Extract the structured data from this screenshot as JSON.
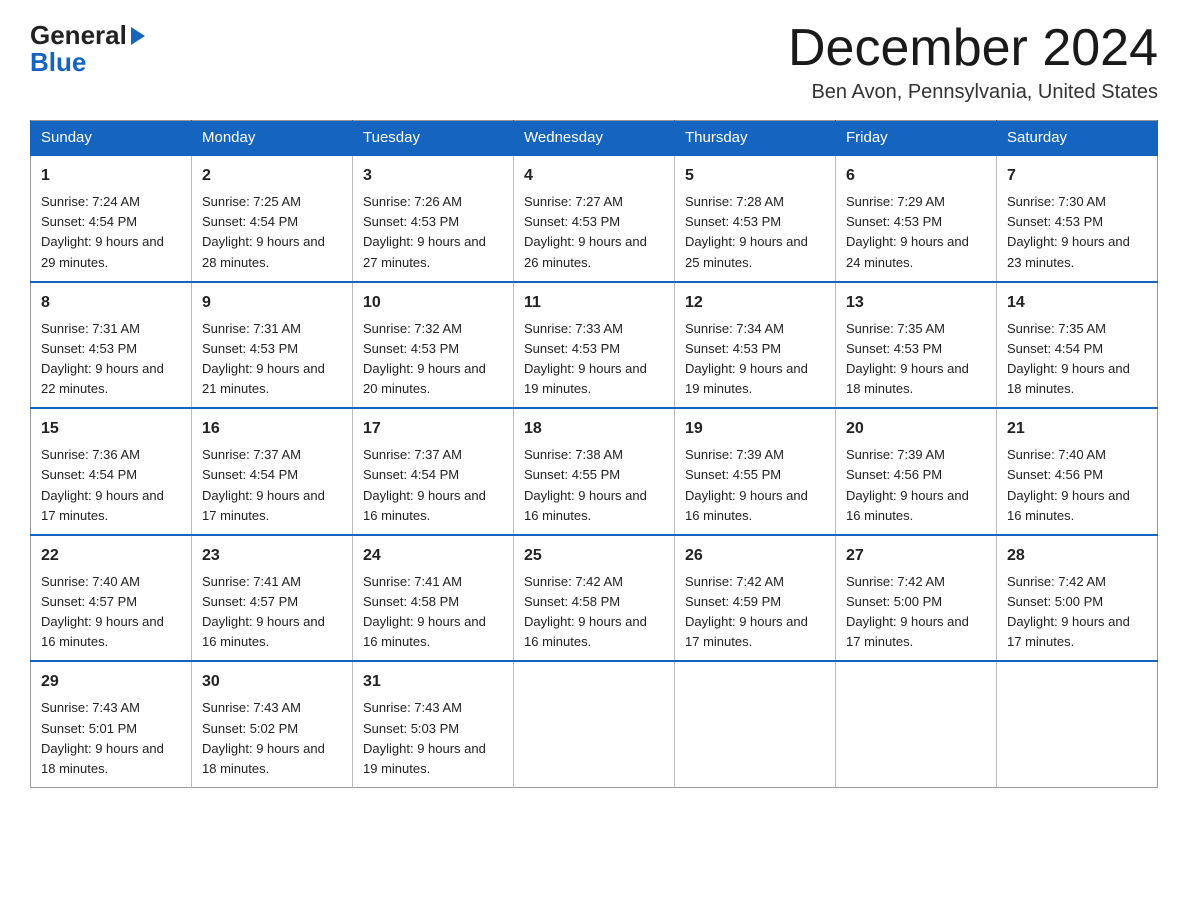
{
  "header": {
    "logo_line1": "General",
    "logo_line2": "Blue",
    "month_title": "December 2024",
    "location": "Ben Avon, Pennsylvania, United States"
  },
  "weekdays": [
    "Sunday",
    "Monday",
    "Tuesday",
    "Wednesday",
    "Thursday",
    "Friday",
    "Saturday"
  ],
  "weeks": [
    [
      {
        "day": "1",
        "sunrise": "7:24 AM",
        "sunset": "4:54 PM",
        "daylight": "9 hours and 29 minutes."
      },
      {
        "day": "2",
        "sunrise": "7:25 AM",
        "sunset": "4:54 PM",
        "daylight": "9 hours and 28 minutes."
      },
      {
        "day": "3",
        "sunrise": "7:26 AM",
        "sunset": "4:53 PM",
        "daylight": "9 hours and 27 minutes."
      },
      {
        "day": "4",
        "sunrise": "7:27 AM",
        "sunset": "4:53 PM",
        "daylight": "9 hours and 26 minutes."
      },
      {
        "day": "5",
        "sunrise": "7:28 AM",
        "sunset": "4:53 PM",
        "daylight": "9 hours and 25 minutes."
      },
      {
        "day": "6",
        "sunrise": "7:29 AM",
        "sunset": "4:53 PM",
        "daylight": "9 hours and 24 minutes."
      },
      {
        "day": "7",
        "sunrise": "7:30 AM",
        "sunset": "4:53 PM",
        "daylight": "9 hours and 23 minutes."
      }
    ],
    [
      {
        "day": "8",
        "sunrise": "7:31 AM",
        "sunset": "4:53 PM",
        "daylight": "9 hours and 22 minutes."
      },
      {
        "day": "9",
        "sunrise": "7:31 AM",
        "sunset": "4:53 PM",
        "daylight": "9 hours and 21 minutes."
      },
      {
        "day": "10",
        "sunrise": "7:32 AM",
        "sunset": "4:53 PM",
        "daylight": "9 hours and 20 minutes."
      },
      {
        "day": "11",
        "sunrise": "7:33 AM",
        "sunset": "4:53 PM",
        "daylight": "9 hours and 19 minutes."
      },
      {
        "day": "12",
        "sunrise": "7:34 AM",
        "sunset": "4:53 PM",
        "daylight": "9 hours and 19 minutes."
      },
      {
        "day": "13",
        "sunrise": "7:35 AM",
        "sunset": "4:53 PM",
        "daylight": "9 hours and 18 minutes."
      },
      {
        "day": "14",
        "sunrise": "7:35 AM",
        "sunset": "4:54 PM",
        "daylight": "9 hours and 18 minutes."
      }
    ],
    [
      {
        "day": "15",
        "sunrise": "7:36 AM",
        "sunset": "4:54 PM",
        "daylight": "9 hours and 17 minutes."
      },
      {
        "day": "16",
        "sunrise": "7:37 AM",
        "sunset": "4:54 PM",
        "daylight": "9 hours and 17 minutes."
      },
      {
        "day": "17",
        "sunrise": "7:37 AM",
        "sunset": "4:54 PM",
        "daylight": "9 hours and 16 minutes."
      },
      {
        "day": "18",
        "sunrise": "7:38 AM",
        "sunset": "4:55 PM",
        "daylight": "9 hours and 16 minutes."
      },
      {
        "day": "19",
        "sunrise": "7:39 AM",
        "sunset": "4:55 PM",
        "daylight": "9 hours and 16 minutes."
      },
      {
        "day": "20",
        "sunrise": "7:39 AM",
        "sunset": "4:56 PM",
        "daylight": "9 hours and 16 minutes."
      },
      {
        "day": "21",
        "sunrise": "7:40 AM",
        "sunset": "4:56 PM",
        "daylight": "9 hours and 16 minutes."
      }
    ],
    [
      {
        "day": "22",
        "sunrise": "7:40 AM",
        "sunset": "4:57 PM",
        "daylight": "9 hours and 16 minutes."
      },
      {
        "day": "23",
        "sunrise": "7:41 AM",
        "sunset": "4:57 PM",
        "daylight": "9 hours and 16 minutes."
      },
      {
        "day": "24",
        "sunrise": "7:41 AM",
        "sunset": "4:58 PM",
        "daylight": "9 hours and 16 minutes."
      },
      {
        "day": "25",
        "sunrise": "7:42 AM",
        "sunset": "4:58 PM",
        "daylight": "9 hours and 16 minutes."
      },
      {
        "day": "26",
        "sunrise": "7:42 AM",
        "sunset": "4:59 PM",
        "daylight": "9 hours and 17 minutes."
      },
      {
        "day": "27",
        "sunrise": "7:42 AM",
        "sunset": "5:00 PM",
        "daylight": "9 hours and 17 minutes."
      },
      {
        "day": "28",
        "sunrise": "7:42 AM",
        "sunset": "5:00 PM",
        "daylight": "9 hours and 17 minutes."
      }
    ],
    [
      {
        "day": "29",
        "sunrise": "7:43 AM",
        "sunset": "5:01 PM",
        "daylight": "9 hours and 18 minutes."
      },
      {
        "day": "30",
        "sunrise": "7:43 AM",
        "sunset": "5:02 PM",
        "daylight": "9 hours and 18 minutes."
      },
      {
        "day": "31",
        "sunrise": "7:43 AM",
        "sunset": "5:03 PM",
        "daylight": "9 hours and 19 minutes."
      },
      null,
      null,
      null,
      null
    ]
  ],
  "labels": {
    "sunrise_prefix": "Sunrise: ",
    "sunset_prefix": "Sunset: ",
    "daylight_prefix": "Daylight: "
  }
}
